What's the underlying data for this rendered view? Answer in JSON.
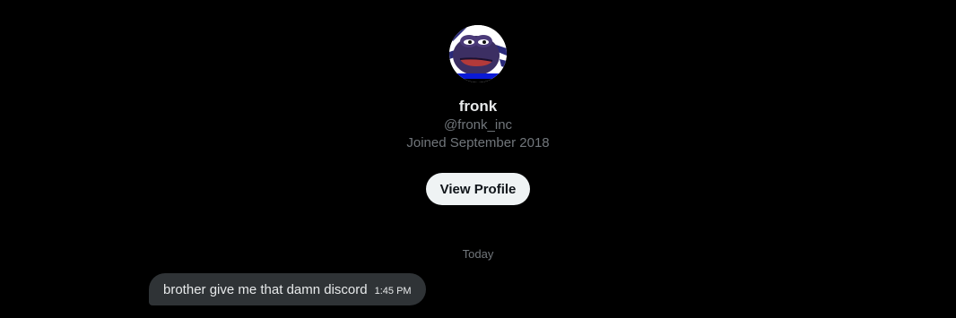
{
  "profile": {
    "display_name": "fronk",
    "handle": "@fronk_inc",
    "joined": "Joined September 2018",
    "avatar_icon": "pepe-frog-avatar",
    "view_profile_label": "View Profile"
  },
  "conversation": {
    "day_label": "Today",
    "messages": [
      {
        "text": "brother give me that damn discord",
        "time": "1:45 PM"
      }
    ]
  },
  "colors": {
    "background": "#000000",
    "primary_text": "#e7e9ea",
    "secondary_text": "#71767b",
    "button_bg": "#eff3f4",
    "bubble_bg": "#2f3336"
  }
}
